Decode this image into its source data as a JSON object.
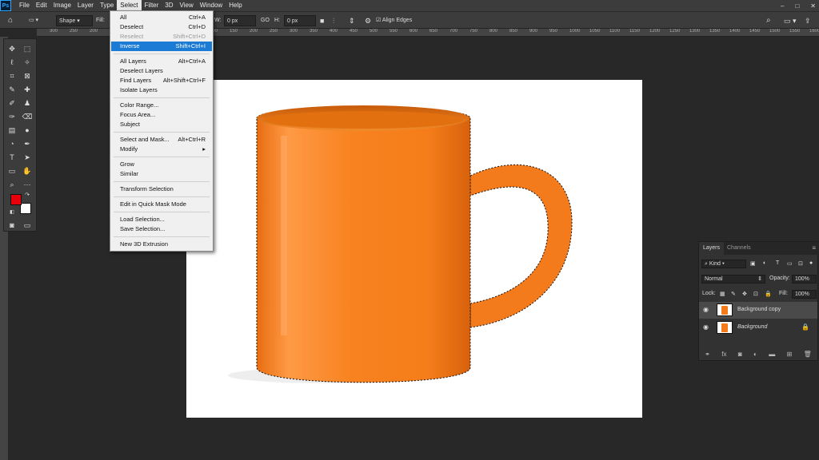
{
  "app": {
    "logo": "Ps"
  },
  "menu": [
    "File",
    "Edit",
    "Image",
    "Layer",
    "Type",
    "Select",
    "Filter",
    "3D",
    "View",
    "Window",
    "Help"
  ],
  "active_menu": "Select",
  "options_bar": {
    "shape_label": "Shape",
    "fill_label": "Fill:",
    "w_label": "W:",
    "w_value": "0 px",
    "go_label": "GO",
    "h_label": "H:",
    "h_value": "0 px",
    "align_edges": "Align Edges"
  },
  "ruler_ticks": [
    "300",
    "250",
    "200",
    "150",
    "100",
    "50",
    "0",
    "50",
    "100",
    "150",
    "200",
    "250",
    "300",
    "350",
    "400",
    "450",
    "500",
    "550",
    "600",
    "650",
    "700",
    "750",
    "800",
    "850",
    "900",
    "950",
    "1000",
    "1050",
    "1100",
    "1150",
    "1200",
    "1250",
    "1300",
    "1350",
    "1400",
    "1450",
    "1500",
    "1550",
    "1600"
  ],
  "select_menu": {
    "items": [
      {
        "label": "All",
        "shortcut": "Ctrl+A",
        "state": "normal"
      },
      {
        "label": "Deselect",
        "shortcut": "Ctrl+D",
        "state": "normal"
      },
      {
        "label": "Reselect",
        "shortcut": "Shift+Ctrl+D",
        "state": "disabled"
      },
      {
        "label": "Inverse",
        "shortcut": "Shift+Ctrl+I",
        "state": "highlighted"
      },
      {
        "label": "All Layers",
        "shortcut": "Alt+Ctrl+A",
        "state": "normal"
      },
      {
        "label": "Deselect Layers",
        "shortcut": "",
        "state": "normal"
      },
      {
        "label": "Find Layers",
        "shortcut": "Alt+Shift+Ctrl+F",
        "state": "normal"
      },
      {
        "label": "Isolate Layers",
        "shortcut": "",
        "state": "normal"
      },
      {
        "label": "Color Range...",
        "shortcut": "",
        "state": "normal"
      },
      {
        "label": "Focus Area...",
        "shortcut": "",
        "state": "normal"
      },
      {
        "label": "Subject",
        "shortcut": "",
        "state": "normal"
      },
      {
        "label": "Select and Mask...",
        "shortcut": "Alt+Ctrl+R",
        "state": "normal"
      },
      {
        "label": "Modify",
        "shortcut": "▸",
        "state": "normal"
      },
      {
        "label": "Grow",
        "shortcut": "",
        "state": "normal"
      },
      {
        "label": "Similar",
        "shortcut": "",
        "state": "normal"
      },
      {
        "label": "Transform Selection",
        "shortcut": "",
        "state": "normal"
      },
      {
        "label": "Edit in Quick Mask Mode",
        "shortcut": "",
        "state": "normal"
      },
      {
        "label": "Load Selection...",
        "shortcut": "",
        "state": "normal"
      },
      {
        "label": "Save Selection...",
        "shortcut": "",
        "state": "normal"
      },
      {
        "label": "New 3D Extrusion",
        "shortcut": "",
        "state": "normal"
      }
    ]
  },
  "layers_panel": {
    "tabs": [
      "Layers",
      "Channels"
    ],
    "kind_label": "Kind",
    "blend_mode": "Normal",
    "opacity_label": "Opacity:",
    "opacity_value": "100%",
    "lock_label": "Lock:",
    "fill_label": "Fill:",
    "fill_value": "100%",
    "layers": [
      {
        "name": "Background copy",
        "selected": true,
        "italic": false,
        "locked": false
      },
      {
        "name": "Background",
        "selected": false,
        "italic": true,
        "locked": true
      }
    ]
  },
  "colors": {
    "foreground": "#e8000b",
    "background": "#ffffff",
    "mug": "#f47b1c",
    "highlight": "#1c7bd4"
  }
}
